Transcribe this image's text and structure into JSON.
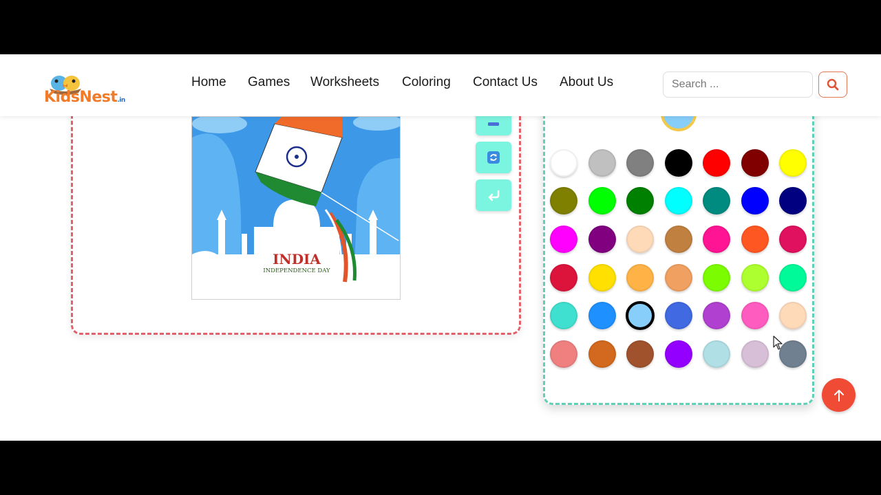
{
  "brand": {
    "logo_text_main": "KidsNest",
    "logo_text_suffix": ".in"
  },
  "nav": {
    "items": [
      "Home",
      "Games",
      "Worksheets",
      "Coloring",
      "Contact Us",
      "About Us"
    ]
  },
  "search": {
    "placeholder": "Search ...",
    "value": "",
    "button_icon": "search-icon"
  },
  "artwork": {
    "title": "INDIA",
    "subtitle": "INDEPENDENCE DAY"
  },
  "tools": {
    "icons": [
      "minus-icon",
      "refresh-icon",
      "undo-icon"
    ]
  },
  "palette": {
    "current_color": "#87cefa",
    "selected_index": 30,
    "colors": [
      "#ffffff",
      "#c0c0c0",
      "#808080",
      "#000000",
      "#ff0000",
      "#800000",
      "#ffff00",
      "#808000",
      "#00ff00",
      "#008000",
      "#00ffff",
      "#008b80",
      "#0000ff",
      "#000080",
      "#ff00ff",
      "#800080",
      "#ffdab9",
      "#c08040",
      "#ff1493",
      "#ff5722",
      "#e0115f",
      "#dc143c",
      "#ffe000",
      "#ffb347",
      "#f0a060",
      "#7cfc00",
      "#adff2f",
      "#00fa9a",
      "#40e0d0",
      "#1e90ff",
      "#87cefa",
      "#4169e1",
      "#b040d0",
      "#ff5cc0",
      "#ffdab9",
      "#f08080",
      "#d2691e",
      "#a0522d",
      "#9400ff",
      "#b0e0e6",
      "#d8bfd8",
      "#708090"
    ]
  },
  "colors": {
    "accent": "#f04b35",
    "canvas_border": "#e2606a",
    "palette_border": "#5fd0b5",
    "tool_button": "#7cf5e0"
  }
}
